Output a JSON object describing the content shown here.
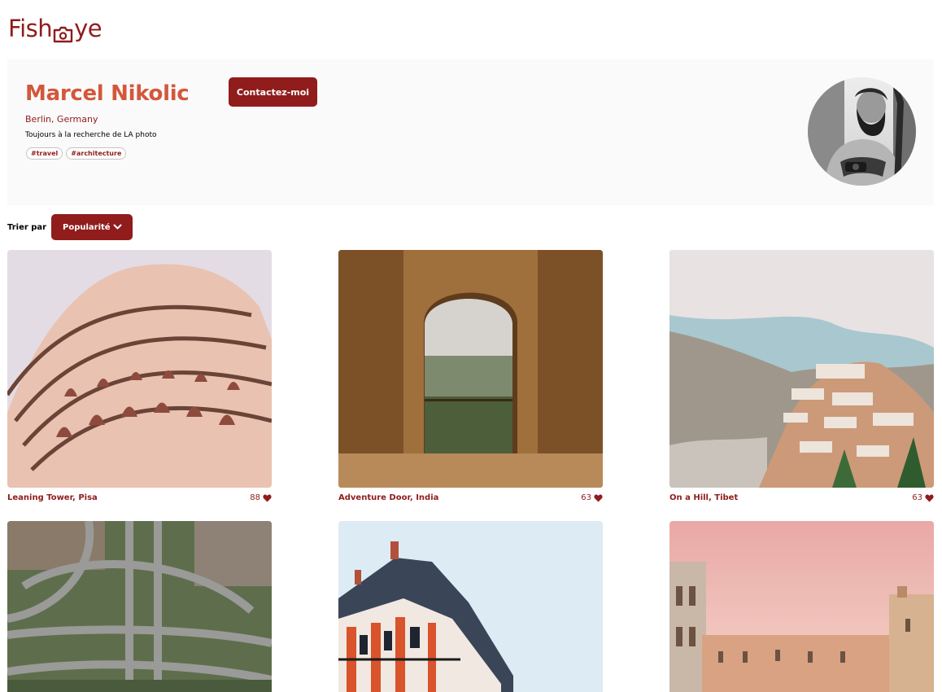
{
  "brand": {
    "logo_left": "Fish",
    "logo_right": "ye",
    "accent": "#901C1C",
    "name_color": "#D3573C"
  },
  "photographer": {
    "name": "Marcel Nikolic",
    "location": "Berlin, Germany",
    "tagline": "Toujours à la recherche de LA photo",
    "tags": [
      "#travel",
      "#architecture"
    ],
    "contact_label": "Contactez-moi",
    "avatar_icon": "portrait-photo"
  },
  "sort": {
    "label": "Trier par",
    "selected": "Popularité",
    "icon": "chevron-down-icon"
  },
  "gallery": [
    {
      "title": "Leaning Tower, Pisa",
      "likes": "88"
    },
    {
      "title": "Adventure Door, India",
      "likes": "63"
    },
    {
      "title": "On a Hill, Tibet",
      "likes": "63"
    },
    {
      "title": "",
      "likes": ""
    },
    {
      "title": "",
      "likes": ""
    },
    {
      "title": "",
      "likes": ""
    }
  ]
}
